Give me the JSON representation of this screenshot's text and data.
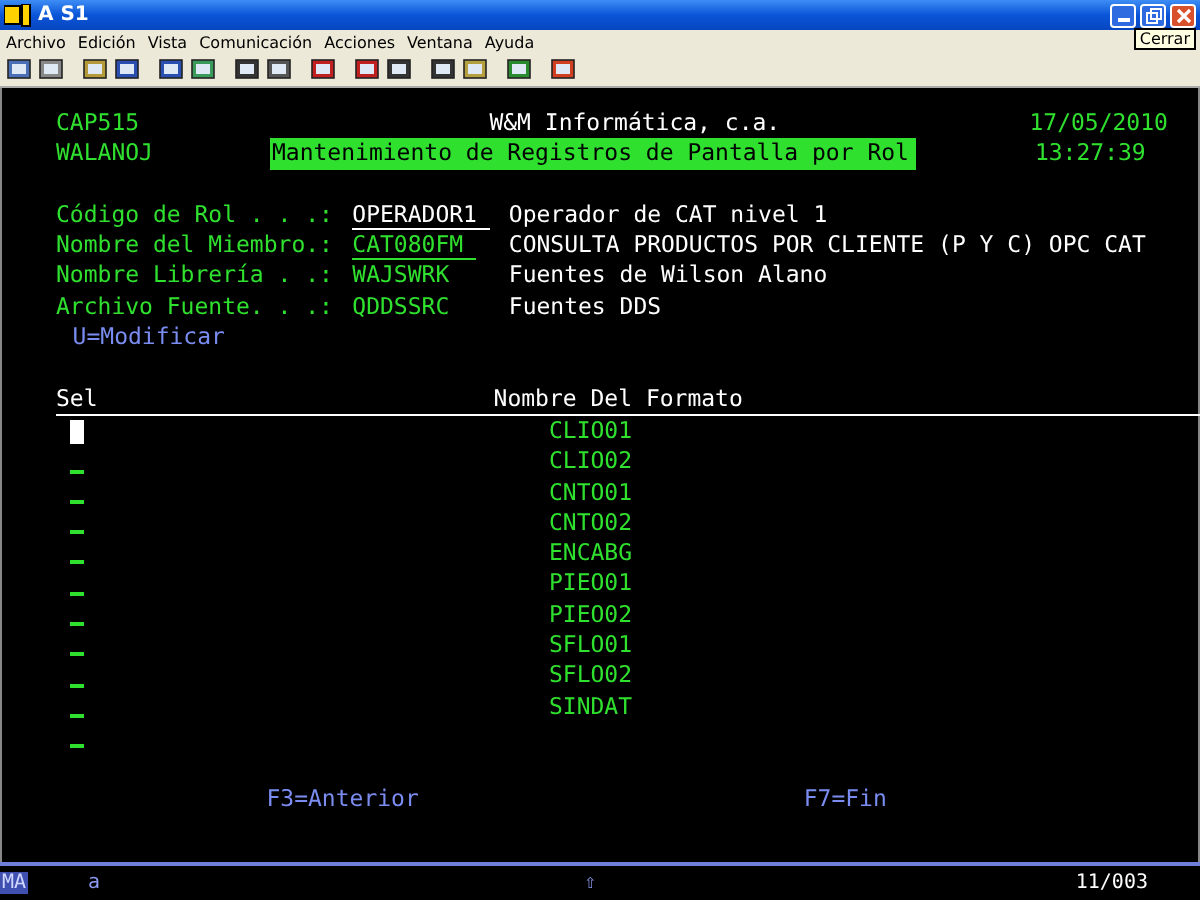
{
  "window": {
    "title": "A S1",
    "tooltip": "Cerrar"
  },
  "menu": [
    "Archivo",
    "Edición",
    "Vista",
    "Comunicación",
    "Acciones",
    "Ventana",
    "Ayuda"
  ],
  "screen": {
    "program": "CAP515",
    "company": "W&M Informática, c.a.",
    "date": "17/05/2010",
    "user": "WALANOJ",
    "title": "Mantenimiento de Registros de Pantalla por Rol",
    "time": "13:27:39",
    "fields": [
      {
        "label": "Código de Rol . . .:",
        "value": "OPERADOR1",
        "editable": true,
        "bright": true,
        "description": "Operador de CAT nivel 1"
      },
      {
        "label": "Nombre del Miembro.:",
        "value": "CAT080FM",
        "editable": true,
        "bright": false,
        "description": "CONSULTA PRODUCTOS POR CLIENTE (P Y C) OPC CAT"
      },
      {
        "label": "Nombre Librería . .:",
        "value": "WAJSWRK",
        "editable": false,
        "bright": false,
        "description": "Fuentes de Wilson Alano"
      },
      {
        "label": "Archivo Fuente. . .:",
        "value": "QDDSSRC",
        "editable": false,
        "bright": false,
        "description": "Fuentes DDS"
      }
    ],
    "options": "U=Modificar",
    "table": {
      "columns": [
        "Sel",
        "Nombre Del Formato"
      ],
      "rows": [
        {
          "cursor": true,
          "name": "CLIO01"
        },
        {
          "cursor": false,
          "name": "CLIO02"
        },
        {
          "cursor": false,
          "name": "CNTO01"
        },
        {
          "cursor": false,
          "name": "CNTO02"
        },
        {
          "cursor": false,
          "name": "ENCABG"
        },
        {
          "cursor": false,
          "name": "PIEO01"
        },
        {
          "cursor": false,
          "name": "PIEO02"
        },
        {
          "cursor": false,
          "name": "SFLO01"
        },
        {
          "cursor": false,
          "name": "SFLO02"
        },
        {
          "cursor": false,
          "name": "SINDAT"
        },
        {
          "cursor": false
        }
      ]
    },
    "function_keys": [
      "F3=Anterior",
      "F7=Fin"
    ]
  },
  "status_bar": {
    "mode": "MA",
    "indicator": "a",
    "shift": "⇧",
    "position": "11/003"
  }
}
